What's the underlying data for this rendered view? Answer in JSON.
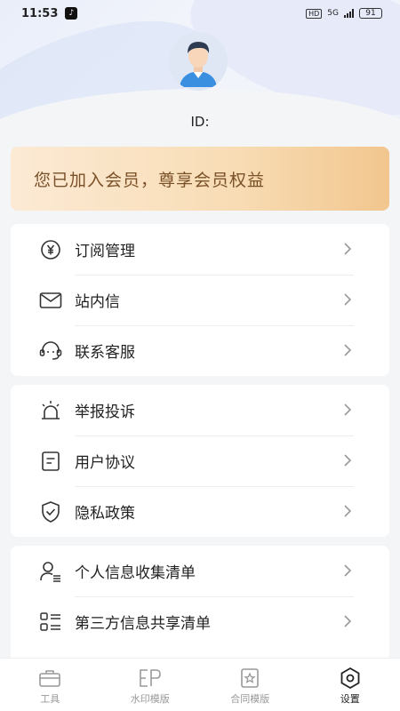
{
  "status_bar": {
    "time": "11:53",
    "hd_label": "HD",
    "network": "5G",
    "battery": "91"
  },
  "profile": {
    "id_label": "ID:"
  },
  "member_banner": {
    "text": "您已加入会员，尊享会员权益"
  },
  "menu_group_1": [
    {
      "label": "订阅管理",
      "icon": "yen-circle-icon"
    },
    {
      "label": "站内信",
      "icon": "mail-icon"
    },
    {
      "label": "联系客服",
      "icon": "headset-icon"
    }
  ],
  "menu_group_2": [
    {
      "label": "举报投诉",
      "icon": "alarm-icon"
    },
    {
      "label": "用户协议",
      "icon": "document-icon"
    },
    {
      "label": "隐私政策",
      "icon": "shield-check-icon"
    }
  ],
  "menu_group_3": [
    {
      "label": "个人信息收集清单",
      "icon": "user-list-icon"
    },
    {
      "label": "第三方信息共享清单",
      "icon": "share-list-icon"
    }
  ],
  "tabbar": [
    {
      "label": "工具",
      "icon": "toolbox-icon",
      "active": false
    },
    {
      "label": "水印模版",
      "icon": "watermark-icon",
      "active": false
    },
    {
      "label": "合同模版",
      "icon": "contract-icon",
      "active": false
    },
    {
      "label": "设置",
      "icon": "settings-icon",
      "active": true
    }
  ]
}
